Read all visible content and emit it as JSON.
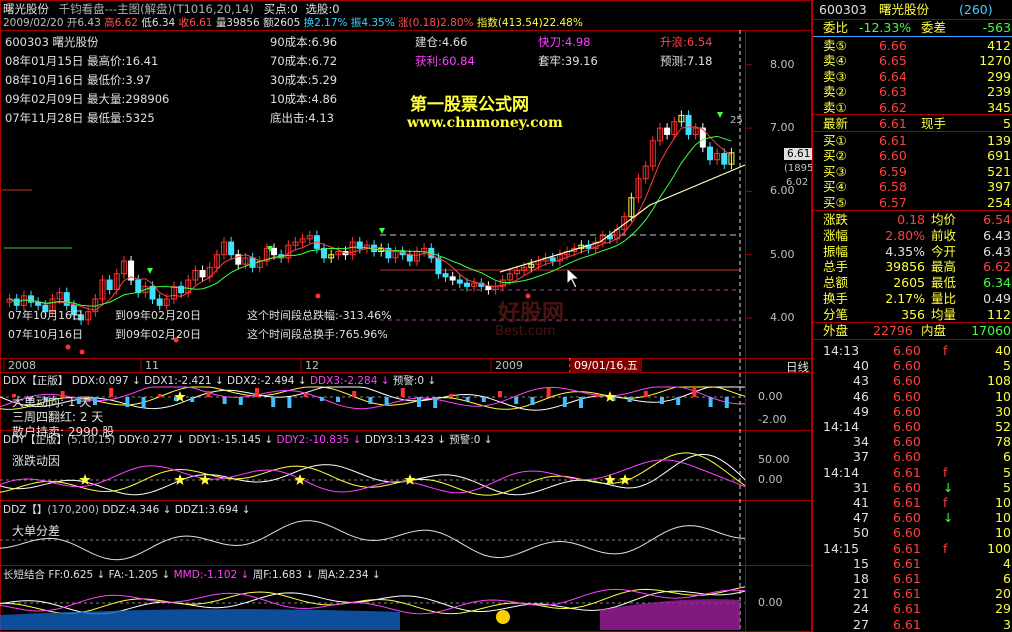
{
  "header": {
    "stock_name": "曙光股份",
    "sub_title": "千钧看盘---主图(解盘)(T1016,20,14)",
    "buy_point": "买点:0",
    "select_stock": "选股:0"
  },
  "ohlc_line": {
    "date": "2009/02/20",
    "open": "开6.43",
    "high": "高6.62",
    "low": "低6.34",
    "close": "收6.61",
    "volume": "量39856",
    "amount": "额2605",
    "turnover": "换2.17%",
    "amplitude": "振4.35%",
    "change": "涨(0.18)2.80%",
    "index": "指数(413.54)22.48%"
  },
  "info_panel": {
    "rows": [
      {
        "left": "600303 曙光股份",
        "mid": "90成本:6.96",
        "c1": "建仓:4.66",
        "c2": "快刀:4.98",
        "c3": "升浪:6.54"
      },
      {
        "left": "08年01月15日 最高价:16.41",
        "mid": "70成本:6.72",
        "c1": "获利:60.84",
        "c2": "套牢:39.16",
        "c3": "预测:7.18"
      },
      {
        "left": "08年10月16日 最低价:3.97",
        "mid": "30成本:5.29"
      },
      {
        "left": "09年02月09日 最大量:298906",
        "mid": "10成本:4.86"
      },
      {
        "left": "07年11月28日 最低量:5325",
        "mid": "底出击:4.13"
      }
    ]
  },
  "watermark": {
    "site_name": "第一股票公式网",
    "site_url": "www.chnmoney.com",
    "faint_name": "好股网",
    "faint_url": "Best.com"
  },
  "period_stats": {
    "from1": "07年10月16日",
    "to1": "到09年02月20日",
    "text1": "这个时间段总跌幅:-313.46%",
    "from2": "07年10月16日",
    "to2": "到09年02月20日",
    "text2": "这个时间段总换手:765.96%"
  },
  "price_axis": {
    "labels": [
      "8.00",
      "7.00",
      "6.00",
      "5.00",
      "4.00"
    ],
    "current": "6.61",
    "tag_mid": "(1895)",
    "tag_low": "6.02",
    "peak": "25"
  },
  "date_axis": {
    "labels": [
      "2008",
      "11",
      "12",
      "2009"
    ],
    "highlight": "09/01/16,五",
    "right_label": "日线"
  },
  "panels": [
    {
      "title": "DDX【正版】",
      "values": [
        {
          "text": "DDX:0.097",
          "color": "#e0e0e0"
        },
        {
          "text": "DDX1:-2.421",
          "color": "#e0e0e0"
        },
        {
          "text": "DDX2:-2.494",
          "color": "#e0e0e0"
        },
        {
          "text": "DDX3:-2.284",
          "color": "#ff40ff"
        },
        {
          "text": "预警:0",
          "color": "#e0e0e0"
        }
      ],
      "notes": [
        "大单动向: 1 天",
        "三周四翻红: 2 天",
        "散户持卖: 2990 股"
      ],
      "axis": [
        "0.00",
        "-2.00"
      ]
    },
    {
      "title": "DDY【正版】",
      "params": "(5,10,15)",
      "values": [
        {
          "text": "DDY:0.277",
          "color": "#e0e0e0"
        },
        {
          "text": "DDY1:-15.145",
          "color": "#e0e0e0"
        },
        {
          "text": "DDY2:-10.835",
          "color": "#ff40ff"
        },
        {
          "text": "DDY3:13.423",
          "color": "#e0e0e0"
        },
        {
          "text": "预警:0",
          "color": "#e0e0e0"
        }
      ],
      "notes": [
        "涨跌动因"
      ],
      "axis": [
        "50.00",
        "0.00"
      ]
    },
    {
      "title": "DDZ【】",
      "params": "(170,200)",
      "values": [
        {
          "text": "DDZ:4.346",
          "color": "#e0e0e0"
        },
        {
          "text": "DDZ1:3.694",
          "color": "#e0e0e0"
        }
      ],
      "notes": [
        "大单分差"
      ],
      "axis": []
    },
    {
      "title": "长短结合",
      "values": [
        {
          "text": "FF:0.625",
          "color": "#e0e0e0"
        },
        {
          "text": "FA:-1.205",
          "color": "#e0e0e0"
        },
        {
          "text": "MMD:-1.102",
          "color": "#ff40ff"
        },
        {
          "text": "周F:1.683",
          "color": "#e0e0e0"
        },
        {
          "text": "周A:2.234",
          "color": "#e0e0e0"
        }
      ],
      "notes": [],
      "axis": [
        "0.00"
      ]
    }
  ],
  "quote": {
    "code": "600303",
    "name": "曙光股份",
    "market_no": "(260)",
    "weibi_label": "委比",
    "weibi": "-12.33%",
    "weicha_label": "委差",
    "weicha": "-563",
    "sell": [
      {
        "label": "卖⑤",
        "price": "6.66",
        "vol": "412"
      },
      {
        "label": "卖④",
        "price": "6.65",
        "vol": "1270"
      },
      {
        "label": "卖③",
        "price": "6.64",
        "vol": "299"
      },
      {
        "label": "卖②",
        "price": "6.63",
        "vol": "239"
      },
      {
        "label": "卖①",
        "price": "6.62",
        "vol": "345"
      }
    ],
    "latest_label": "最新",
    "latest": "6.61",
    "hand_label": "现手",
    "hand": "5",
    "buy": [
      {
        "label": "买①",
        "price": "6.61",
        "vol": "139"
      },
      {
        "label": "买②",
        "price": "6.60",
        "vol": "691"
      },
      {
        "label": "买③",
        "price": "6.59",
        "vol": "521"
      },
      {
        "label": "买④",
        "price": "6.58",
        "vol": "397"
      },
      {
        "label": "买⑤",
        "price": "6.57",
        "vol": "254"
      }
    ],
    "stats": [
      {
        "l1": "涨跌",
        "v1": "0.18",
        "c1": "#ff4040",
        "l2": "均价",
        "v2": "6.54",
        "c2": "#ff4040"
      },
      {
        "l1": "涨幅",
        "v1": "2.80%",
        "c1": "#ff4040",
        "l2": "前收",
        "v2": "6.43",
        "c2": "#e0e0e0"
      },
      {
        "l1": "振幅",
        "v1": "4.35%",
        "c1": "#e0e0e0",
        "l2": "今开",
        "v2": "6.43",
        "c2": "#e0e0e0"
      },
      {
        "l1": "总手",
        "v1": "39856",
        "c1": "#ffff40",
        "l2": "最高",
        "v2": "6.62",
        "c2": "#ff4040"
      },
      {
        "l1": "总额",
        "v1": "2605",
        "c1": "#ffff40",
        "l2": "最低",
        "v2": "6.34",
        "c2": "#40ff40"
      },
      {
        "l1": "换手",
        "v1": "2.17%",
        "c1": "#ffff40",
        "l2": "量比",
        "v2": "0.49",
        "c2": "#e0e0e0"
      },
      {
        "l1": "分笔",
        "v1": "356",
        "c1": "#ffff40",
        "l2": "均量",
        "v2": "112",
        "c2": "#ffff40"
      }
    ],
    "outer_label": "外盘",
    "outer": "22796",
    "inner_label": "内盘",
    "inner": "17060",
    "ticks": [
      {
        "time": "14:13",
        "price": "6.60",
        "flag": "f",
        "vol": "40"
      },
      {
        "time": "40",
        "price": "6.60",
        "flag": "",
        "vol": "5"
      },
      {
        "time": "43",
        "price": "6.60",
        "flag": "",
        "vol": "108"
      },
      {
        "time": "46",
        "price": "6.60",
        "flag": "",
        "vol": "10"
      },
      {
        "time": "49",
        "price": "6.60",
        "flag": "",
        "vol": "30"
      },
      {
        "time": "14:14",
        "price": "6.60",
        "flag": "",
        "vol": "52"
      },
      {
        "time": "34",
        "price": "6.60",
        "flag": "",
        "vol": "78"
      },
      {
        "time": "37",
        "price": "6.60",
        "flag": "",
        "vol": "6"
      },
      {
        "time": "14:14",
        "price": "6.61",
        "flag": "f",
        "vol": "5"
      },
      {
        "time": "31",
        "price": "6.60",
        "flag": "↓",
        "vol": "5"
      },
      {
        "time": "41",
        "price": "6.61",
        "flag": "f",
        "vol": "10"
      },
      {
        "time": "47",
        "price": "6.60",
        "flag": "↓",
        "vol": "10"
      },
      {
        "time": "50",
        "price": "6.60",
        "flag": "",
        "vol": "10"
      },
      {
        "time": "14:15",
        "price": "6.61",
        "flag": "f",
        "vol": "100"
      },
      {
        "time": "15",
        "price": "6.61",
        "flag": "",
        "vol": "4"
      },
      {
        "time": "18",
        "price": "6.61",
        "flag": "",
        "vol": "6"
      },
      {
        "time": "21",
        "price": "6.61",
        "flag": "",
        "vol": "20"
      },
      {
        "time": "24",
        "price": "6.61",
        "flag": "",
        "vol": "29"
      },
      {
        "time": "27",
        "price": "6.61",
        "flag": "",
        "vol": "3"
      }
    ],
    "colors": {
      "up": "#ff4040",
      "down": "#40ff40",
      "label": "#ffff40",
      "neutral": "#e0e0e0",
      "frame": "#c00000"
    }
  }
}
